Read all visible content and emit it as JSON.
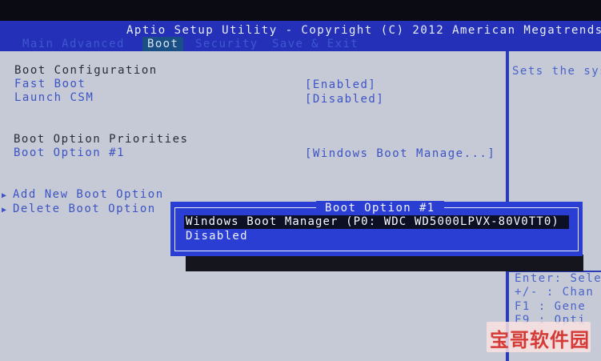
{
  "title_bar": {
    "title": "Aptio Setup Utility - Copyright (C) 2012 American Megatrends,"
  },
  "menu": {
    "tabs": [
      {
        "label": "Main  Advanced"
      },
      {
        "label": "Boot"
      },
      {
        "label": "Security"
      },
      {
        "label": "Save & Exit"
      }
    ]
  },
  "boot_config": {
    "heading": "Boot Configuration",
    "fast_boot": {
      "label": "Fast Boot",
      "value": "[Enabled]"
    },
    "launch_csm": {
      "label": "Launch CSM",
      "value": "[Disabled]"
    }
  },
  "boot_priorities": {
    "heading": "Boot Option Priorities",
    "option1": {
      "label": "Boot Option #1",
      "value": "[Windows Boot Manage...]"
    }
  },
  "submenus": {
    "add": "Add New Boot Option",
    "delete": "Delete Boot Option"
  },
  "help": {
    "description": "Sets the sys",
    "keys": [
      "Enter: Sele",
      "+/-   : Chan",
      "F1    : Gene",
      "F9    : Opti"
    ]
  },
  "popup": {
    "title": "Boot Option #1",
    "options": [
      {
        "label": "Windows Boot Manager (P0: WDC WD5000LPVX-80V0TT0)"
      },
      {
        "label": "Disabled"
      }
    ]
  },
  "watermark": {
    "text": "宝哥软件园"
  }
}
